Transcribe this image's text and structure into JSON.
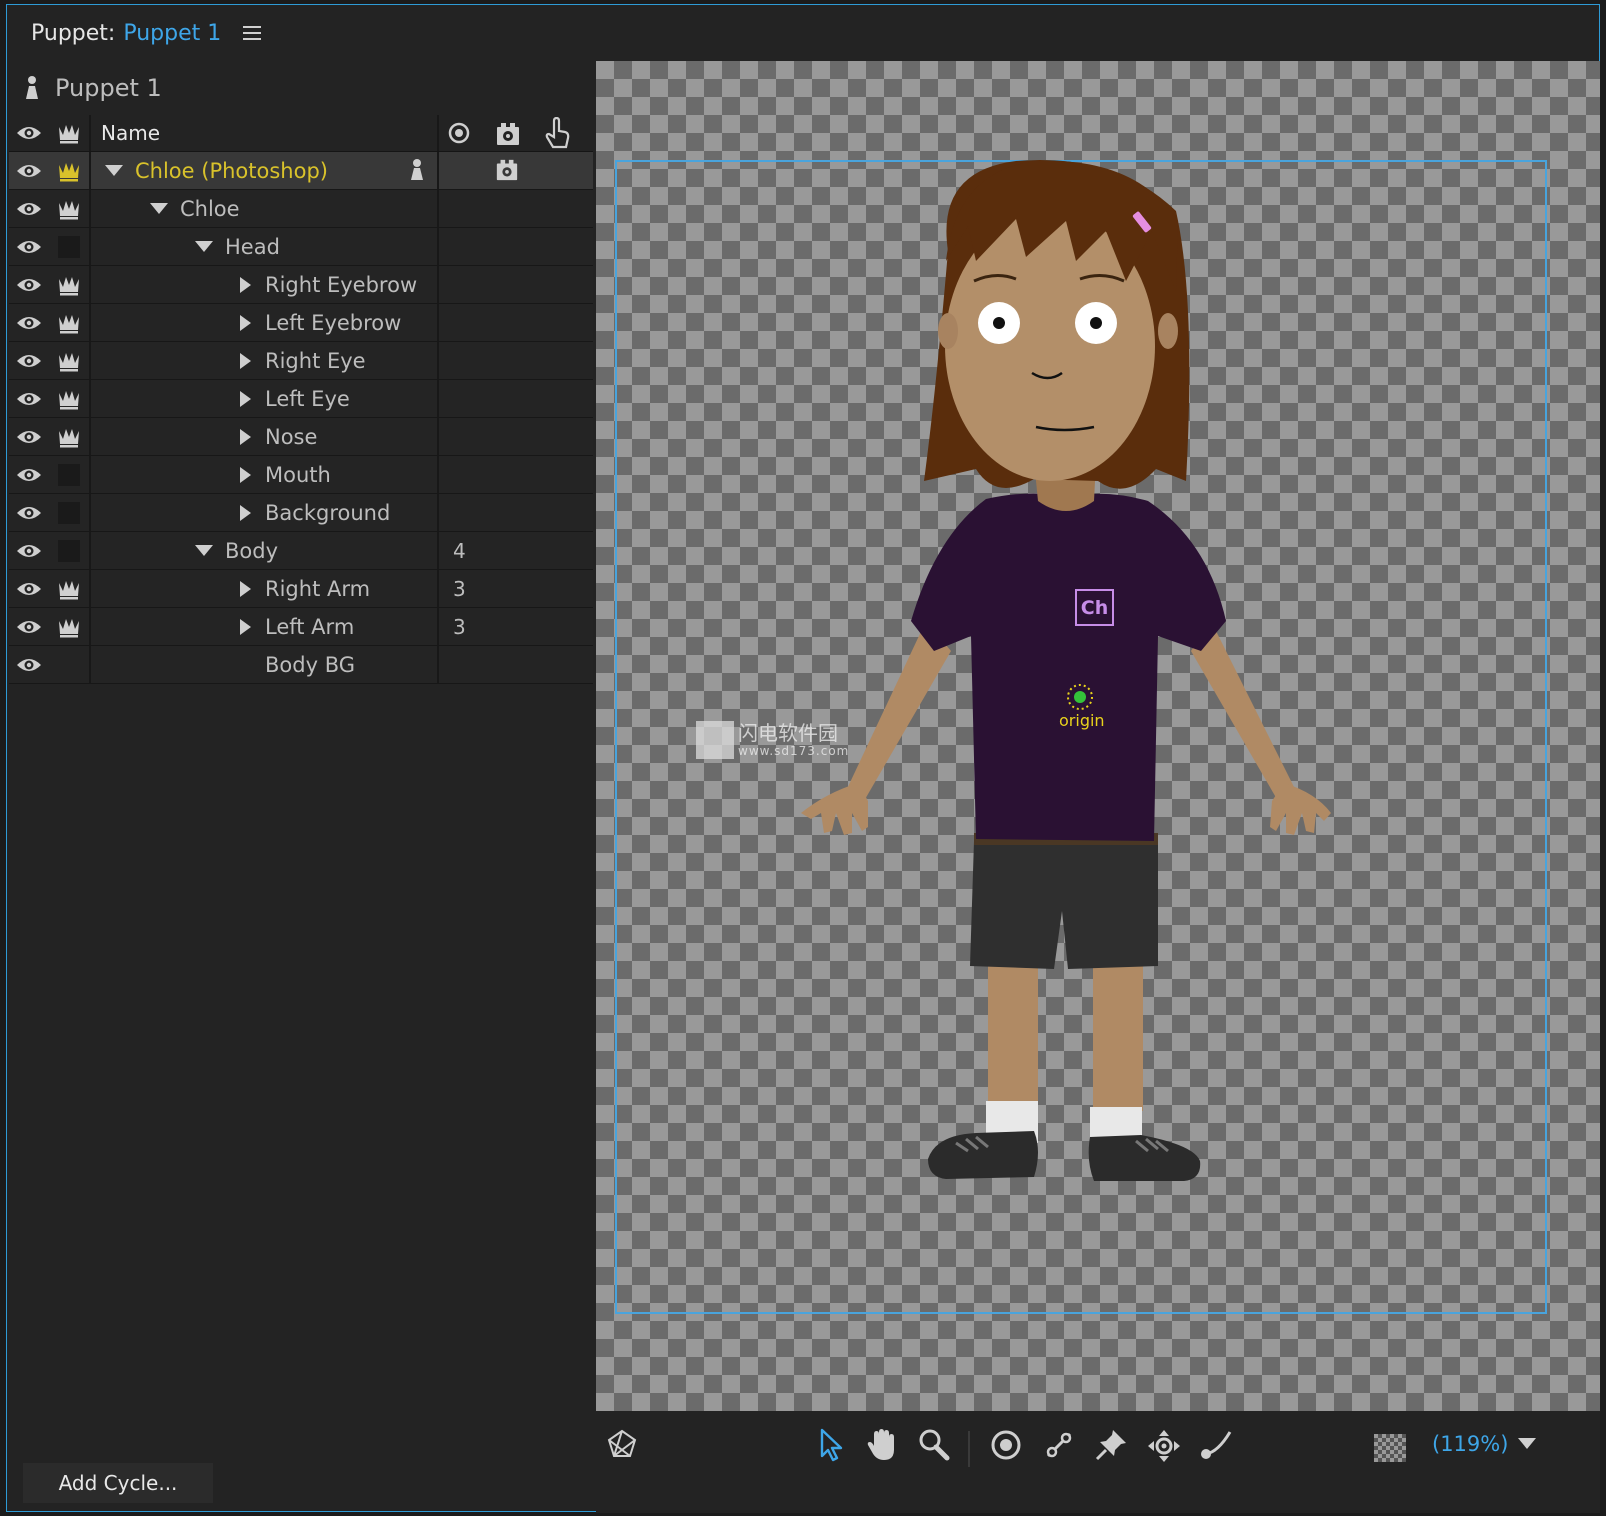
{
  "header": {
    "label": "Puppet:",
    "puppet_name": "Puppet 1"
  },
  "panel": {
    "puppet_title": "Puppet 1",
    "column_name": "Name"
  },
  "layers": [
    {
      "label": "Chloe (Photoshop)",
      "depth": 0,
      "expander": "down",
      "tag": "crown",
      "num": "",
      "selected": true
    },
    {
      "label": "Chloe",
      "depth": 1,
      "expander": "down",
      "tag": "crown",
      "num": ""
    },
    {
      "label": "Head",
      "depth": 2,
      "expander": "down",
      "tag": "none",
      "num": ""
    },
    {
      "label": "Right Eyebrow",
      "depth": 3,
      "expander": "right",
      "tag": "crown",
      "num": ""
    },
    {
      "label": "Left Eyebrow",
      "depth": 3,
      "expander": "right",
      "tag": "crown",
      "num": ""
    },
    {
      "label": "Right Eye",
      "depth": 3,
      "expander": "right",
      "tag": "crown",
      "num": ""
    },
    {
      "label": "Left Eye",
      "depth": 3,
      "expander": "right",
      "tag": "crown",
      "num": ""
    },
    {
      "label": "Nose",
      "depth": 3,
      "expander": "right",
      "tag": "crown",
      "num": ""
    },
    {
      "label": "Mouth",
      "depth": 3,
      "expander": "right",
      "tag": "none",
      "num": ""
    },
    {
      "label": "Background",
      "depth": 3,
      "expander": "right",
      "tag": "none",
      "num": ""
    },
    {
      "label": "Body",
      "depth": 2,
      "expander": "down",
      "tag": "none",
      "num": "4"
    },
    {
      "label": "Right Arm",
      "depth": 3,
      "expander": "right",
      "tag": "crown",
      "num": "3"
    },
    {
      "label": "Left Arm",
      "depth": 3,
      "expander": "right",
      "tag": "crown",
      "num": "3"
    },
    {
      "label": "Body BG",
      "depth": 3,
      "expander": "",
      "tag": "blank",
      "num": ""
    }
  ],
  "buttons": {
    "add_cycle": "Add Cycle..."
  },
  "canvas": {
    "origin_label": "origin",
    "shirt_logo": "Ch"
  },
  "watermark": {
    "cn": "闪电软件园",
    "url": "www.sd173.com"
  },
  "toolbar": {
    "zoom": "(119%)"
  },
  "colors": {
    "accent": "#3ea6e8",
    "selected_text": "#d9c22b",
    "bounds": "#49a4dd"
  }
}
